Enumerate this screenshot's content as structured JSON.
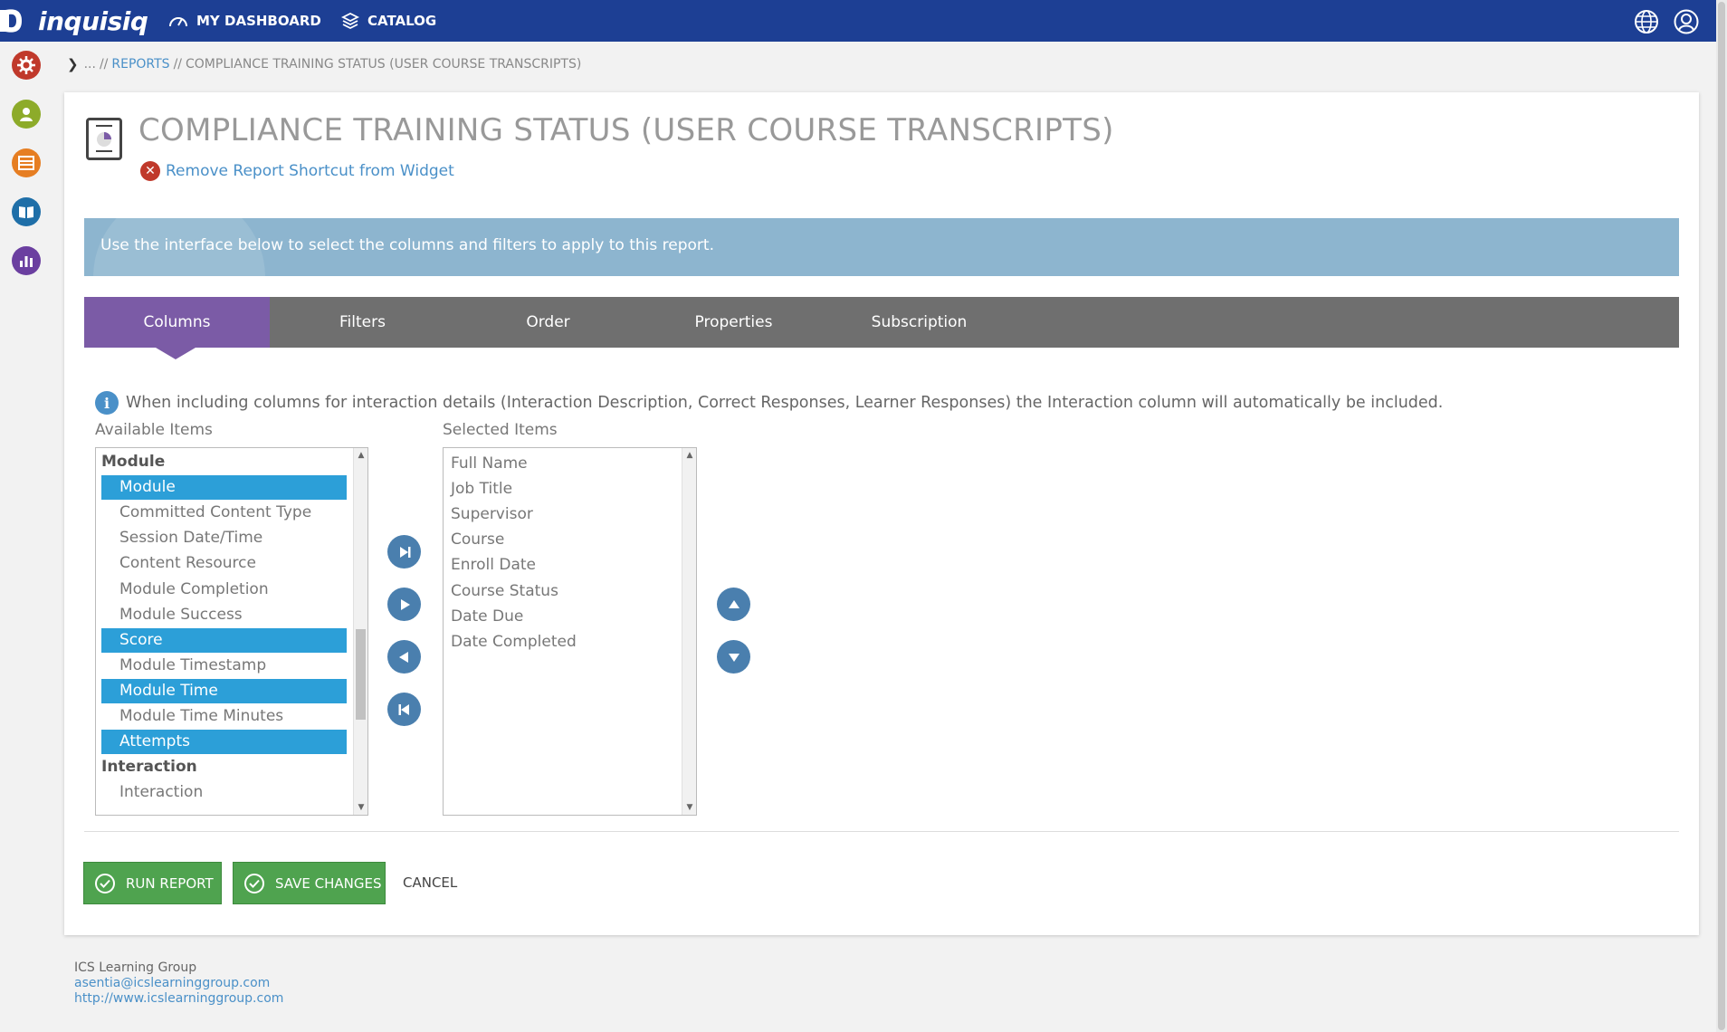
{
  "app": {
    "logo_text": "inquisiq"
  },
  "topnav": {
    "dashboard_label": "MY DASHBOARD",
    "catalog_label": "CATALOG"
  },
  "breadcrumb": {
    "prefix": "...",
    "sep": "//",
    "reports": "REPORTS",
    "current": "COMPLIANCE TRAINING STATUS (USER COURSE TRANSCRIPTS)"
  },
  "page": {
    "title": "COMPLIANCE TRAINING STATUS (USER COURSE TRANSCRIPTS)",
    "remove_link": "Remove Report Shortcut from Widget",
    "instruction": "Use the interface below to select the columns and filters to apply to this report."
  },
  "tabs": [
    {
      "label": "Columns",
      "active": true
    },
    {
      "label": "Filters",
      "active": false
    },
    {
      "label": "Order",
      "active": false
    },
    {
      "label": "Properties",
      "active": false
    },
    {
      "label": "Subscription",
      "active": false
    }
  ],
  "info_text": "When including columns for interaction details (Interaction Description, Correct Responses, Learner Responses) the Interaction column will automatically be included.",
  "available": {
    "label": "Available Items",
    "items": [
      {
        "text": "Module",
        "type": "group"
      },
      {
        "text": "Module",
        "type": "opt",
        "selected": true
      },
      {
        "text": "Committed Content Type",
        "type": "opt"
      },
      {
        "text": "Session Date/Time",
        "type": "opt"
      },
      {
        "text": "Content Resource",
        "type": "opt"
      },
      {
        "text": "Module Completion",
        "type": "opt"
      },
      {
        "text": "Module Success",
        "type": "opt"
      },
      {
        "text": "Score",
        "type": "opt",
        "selected": true
      },
      {
        "text": "Module Timestamp",
        "type": "opt"
      },
      {
        "text": "Module Time",
        "type": "opt",
        "selected": true
      },
      {
        "text": "Module Time Minutes",
        "type": "opt"
      },
      {
        "text": "Attempts",
        "type": "opt",
        "selected": true
      },
      {
        "text": "Interaction",
        "type": "group"
      },
      {
        "text": "Interaction",
        "type": "opt"
      }
    ]
  },
  "selected": {
    "label": "Selected Items",
    "items": [
      "Full Name",
      "Job Title",
      "Supervisor",
      "Course",
      "Enroll Date",
      "Course Status",
      "Date Due",
      "Date Completed"
    ]
  },
  "buttons": {
    "run_report": "RUN REPORT",
    "save_changes": "SAVE CHANGES",
    "cancel": "CANCEL"
  },
  "footer": {
    "company": "ICS Learning Group",
    "email": "asentia@icslearninggroup.com",
    "url": "http://www.icslearninggroup.com"
  },
  "colors": {
    "topbar": "#1d3f94",
    "tab_active": "#7b5ba6",
    "selection": "#2c9fd8",
    "button_green": "#4fa34f",
    "link": "#4a90c8"
  }
}
